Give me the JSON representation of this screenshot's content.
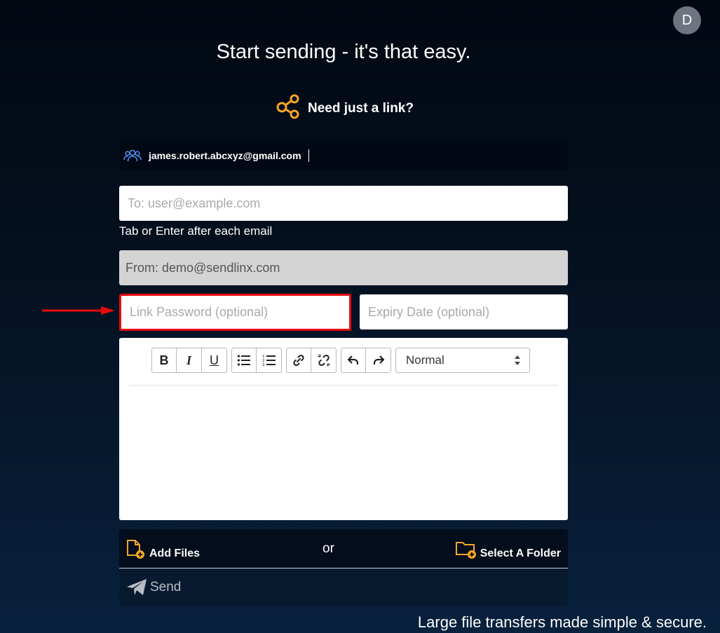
{
  "user": {
    "avatar_initial": "D"
  },
  "header": {
    "title": "Start sending - it's that easy.",
    "link_label": "Need just a link?"
  },
  "account": {
    "email": "james.robert.abcxyz@gmail.com"
  },
  "form": {
    "to_placeholder": "To: user@example.com",
    "to_hint": "Tab or Enter after each email",
    "from_text": "From:  demo@sendlinx.com",
    "password_placeholder": "Link Password (optional)",
    "expiry_placeholder": "Expiry Date (optional)"
  },
  "editor": {
    "toolbar": {
      "bold": "B",
      "italic": "I",
      "underline": "U",
      "format_value": "Normal"
    }
  },
  "files": {
    "add_files": "Add Files",
    "or": "or",
    "select_folder": "Select A Folder"
  },
  "send": {
    "label": "Send"
  },
  "footer": {
    "tagline": "Large file transfers made simple & secure."
  },
  "colors": {
    "accent": "#f5a623",
    "highlight": "#e8090d",
    "icon_blue": "#4a8ef0"
  }
}
